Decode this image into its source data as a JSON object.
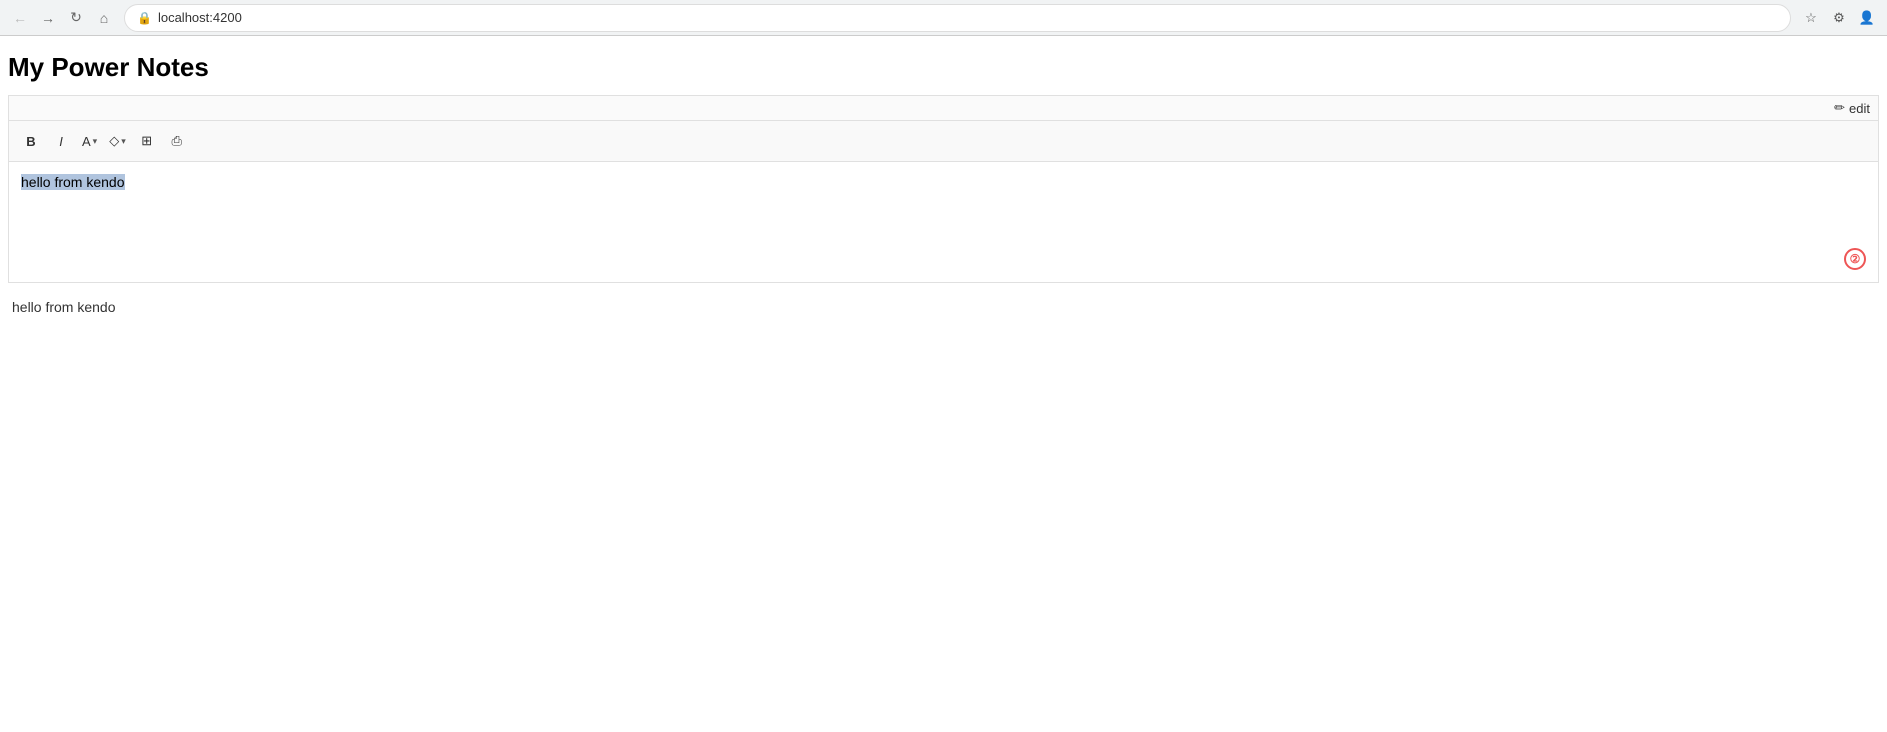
{
  "browser": {
    "url": "localhost:4200",
    "nav": {
      "back_label": "←",
      "forward_label": "→",
      "reload_label": "↻",
      "home_label": "⌂"
    }
  },
  "page": {
    "title": "My Power Notes",
    "edit_button_label": "edit"
  },
  "editor": {
    "toolbar": {
      "bold_label": "B",
      "italic_label": "I",
      "font_size_label": "A",
      "color_label": "◇",
      "table_label": "⊞",
      "print_label": "⎙"
    },
    "content": {
      "text": "hello from kendo"
    }
  },
  "output": {
    "text": "hello from kendo"
  },
  "badge": {
    "value": "②"
  }
}
